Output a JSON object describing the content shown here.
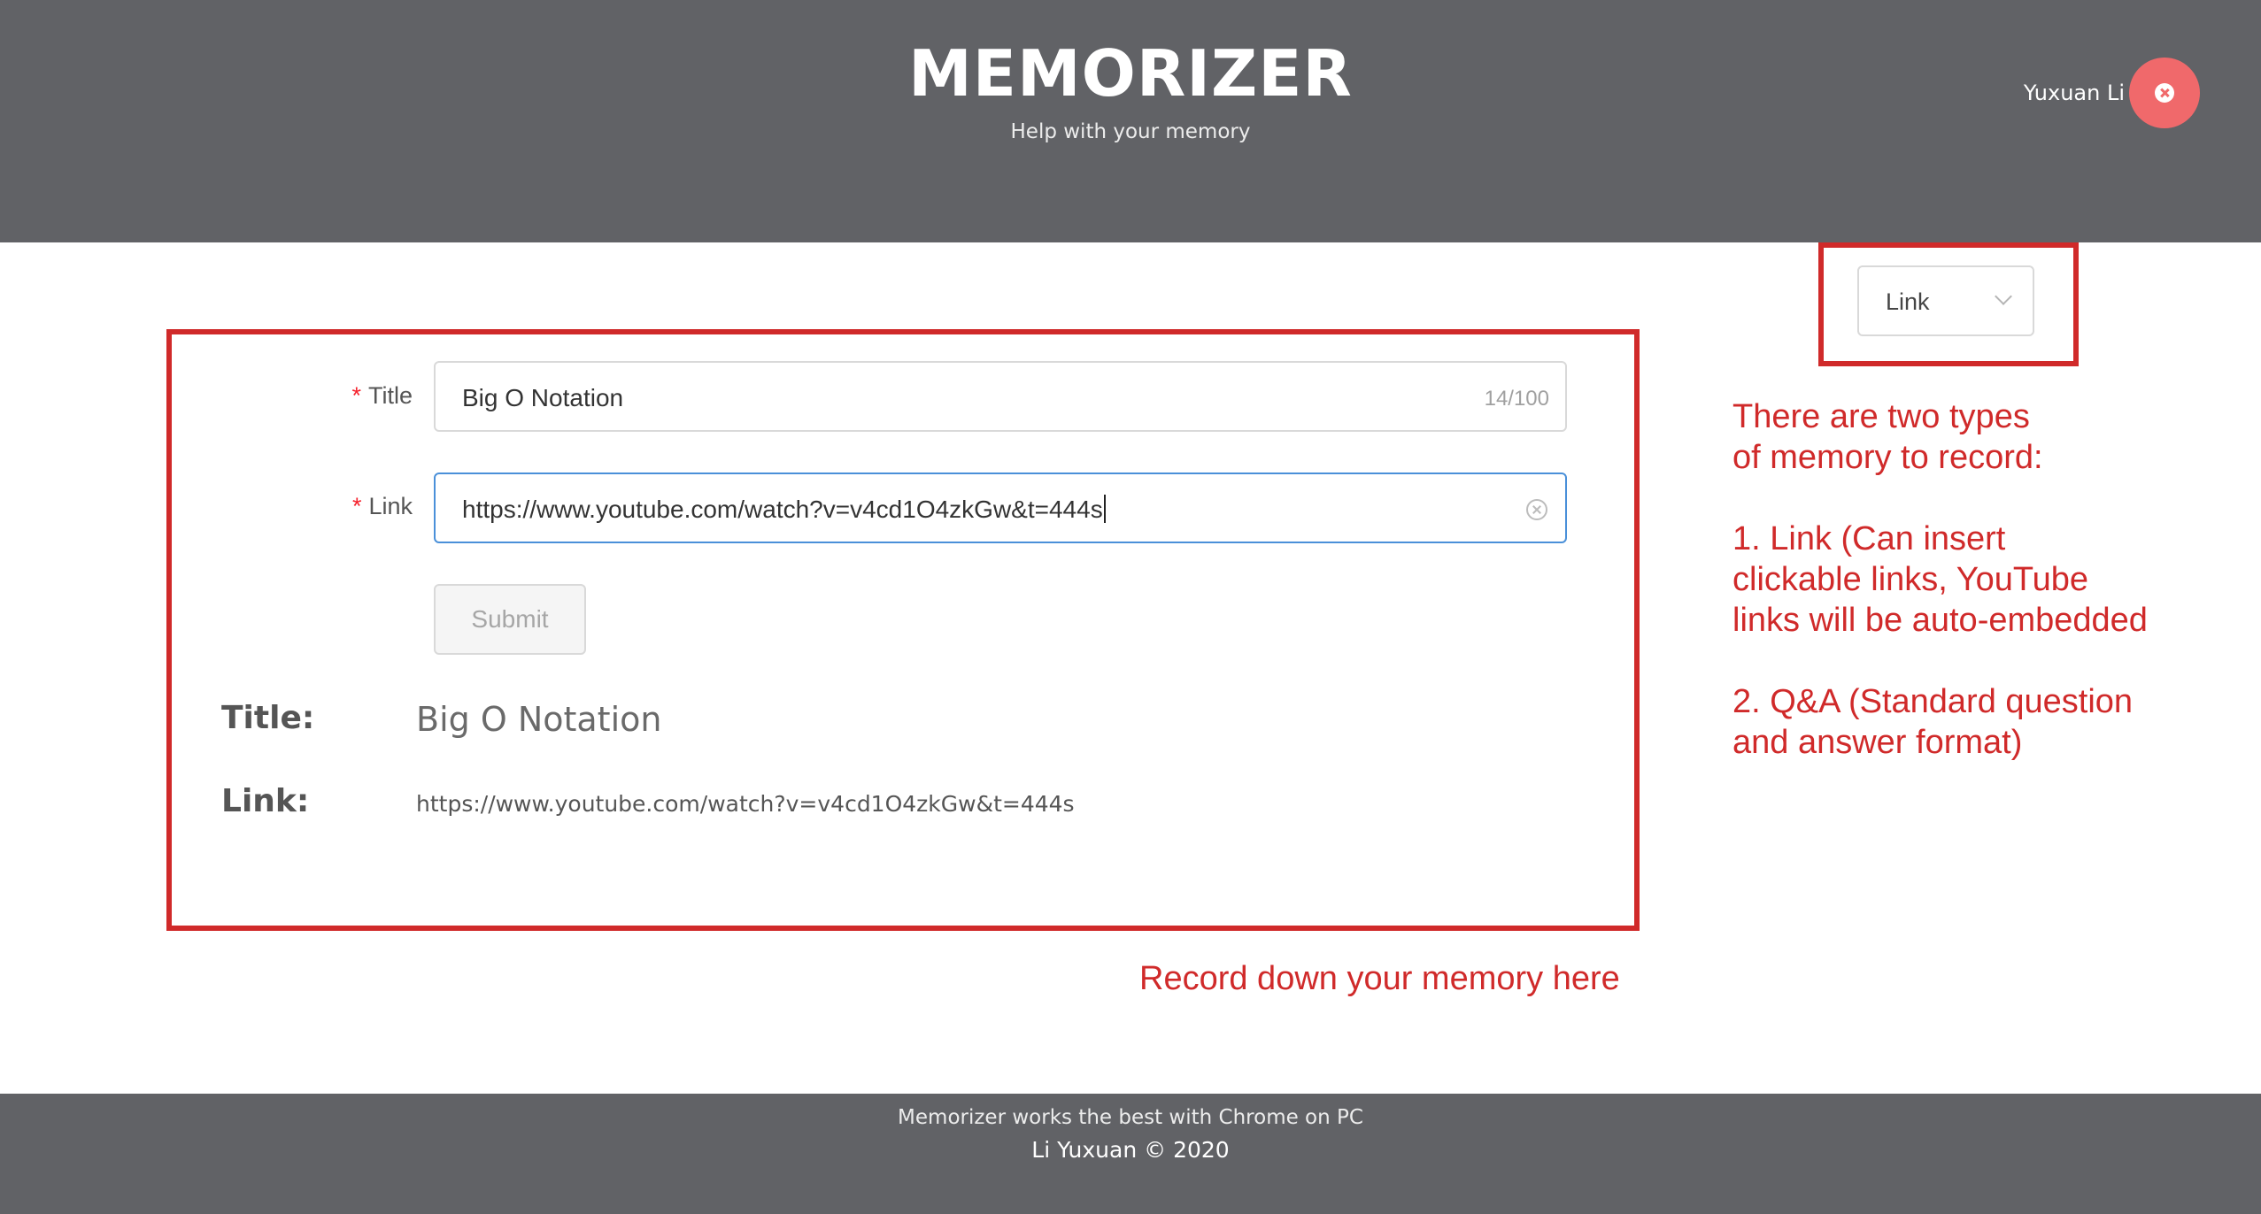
{
  "header": {
    "title": "MEMORIZER",
    "subtitle": "Help with your memory",
    "user_name": "Yuxuan Li",
    "logout_icon": "close-circle-icon"
  },
  "type_select": {
    "value": "Link",
    "icon": "chevron-down-icon"
  },
  "form": {
    "required_mark": "*",
    "title_label": "Title",
    "title_value": "Big O Notation",
    "title_count": "14/100",
    "link_label": "Link",
    "link_value": "https://www.youtube.com/watch?v=v4cd1O4zkGw&t=444s",
    "submit_label": "Submit"
  },
  "preview": {
    "title_label": "Title:",
    "title_value": "Big O Notation",
    "link_label": "Link:",
    "link_value": "https://www.youtube.com/watch?v=v4cd1O4zkGw&t=444s"
  },
  "annotations": {
    "types_line1": "There are two types",
    "types_line2": "of memory to record:",
    "link_line1": "1. Link (Can insert",
    "link_line2": "clickable links, YouTube",
    "link_line3": "links will be auto-embedded",
    "qa_line1": "2. Q&A (Standard question",
    "qa_line2": "and answer format)",
    "record_here": "Record down your memory here",
    "color": "#d02a2a"
  },
  "footer": {
    "line1": "Memorizer works the best with Chrome on PC",
    "line2": "Li Yuxuan © 2020"
  },
  "colors": {
    "header_bg": "#616266",
    "logout_bg": "#f0696b",
    "focus_border": "#4a90d9",
    "required": "#f5222d"
  }
}
